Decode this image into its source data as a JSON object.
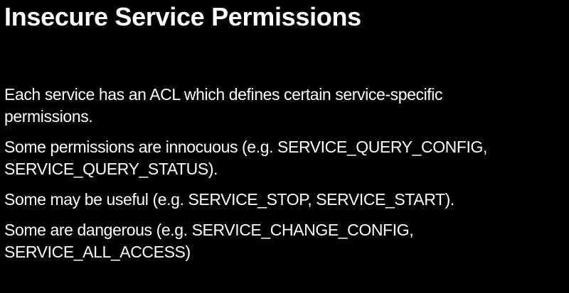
{
  "slide": {
    "title": "Insecure Service Permissions",
    "paragraphs": [
      {
        "lines": [
          "Each service has an ACL which defines certain service-specific",
          "permissions."
        ]
      },
      {
        "lines": [
          "Some permissions are innocuous (e.g. SERVICE_QUERY_CONFIG,",
          "SERVICE_QUERY_STATUS)."
        ]
      },
      {
        "prefix": "Some may be useful (e.g. ",
        "highlight": "SERVICE_STOP, SERVICE_START",
        "suffix": ")."
      },
      {
        "line1_prefix": "Some are dangerous (e.g. ",
        "line1_highlight": "SERVICE_CHANGE_CONFIG,",
        "line2_highlight": "SERVICE_ALL_ACCESS",
        "line2_suffix": ")"
      }
    ]
  },
  "colors": {
    "background": "#000000",
    "text": "#ffffff"
  }
}
